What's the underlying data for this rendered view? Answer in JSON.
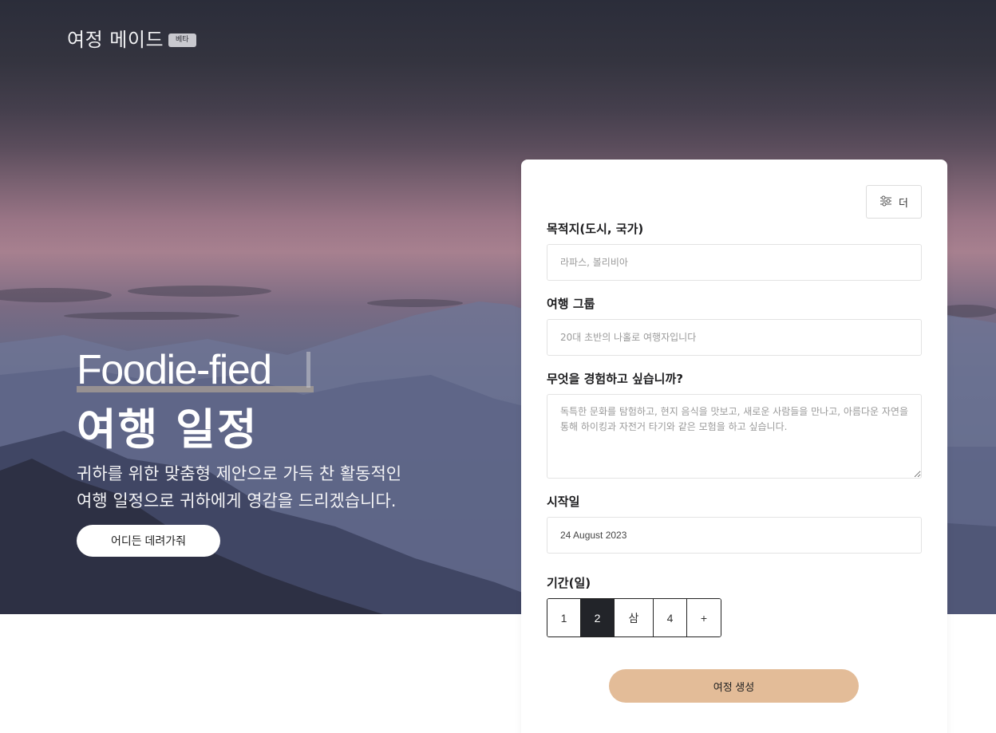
{
  "header": {
    "brand": "여정 메이드",
    "badge": "베타"
  },
  "hero": {
    "title_en": "Foodie-fied",
    "title_ko": "여행 일정",
    "subtitle_line1": "귀하를 위한 맞춤형 제안으로 가득 찬 활동적인",
    "subtitle_line2": "여행 일정으로 귀하에게 영감을 드리겠습니다.",
    "cta_label": "어디든 데려가줘"
  },
  "form": {
    "more_button_label": "더",
    "more_button_icon": "sliders-icon",
    "destination": {
      "label": "목적지(도시, 국가)",
      "placeholder": "라파스, 볼리비아",
      "value": ""
    },
    "group": {
      "label": "여행 그룹",
      "placeholder": "20대 초반의 나홀로 여행자입니다",
      "value": ""
    },
    "experience": {
      "label": "무엇을 경험하고 싶습니까?",
      "placeholder": "독특한 문화를 탐험하고, 현지 음식을 맛보고, 새로운 사람들을 만나고, 아름다운 자연을 통해 하이킹과 자전거 타기와 같은 모험을 하고 싶습니다.",
      "value": ""
    },
    "start_date": {
      "label": "시작일",
      "value": "24 August 2023"
    },
    "duration": {
      "label": "기간(일)",
      "options": [
        "1",
        "2",
        "삼",
        "4",
        "+"
      ],
      "selected": "2"
    },
    "submit_label": "여정 생성"
  },
  "colors": {
    "accent": "#e3bc98",
    "selected_option": "#222429",
    "hero_sky_top": "#2b2d3a",
    "hero_sky_pink": "#a7808f"
  }
}
